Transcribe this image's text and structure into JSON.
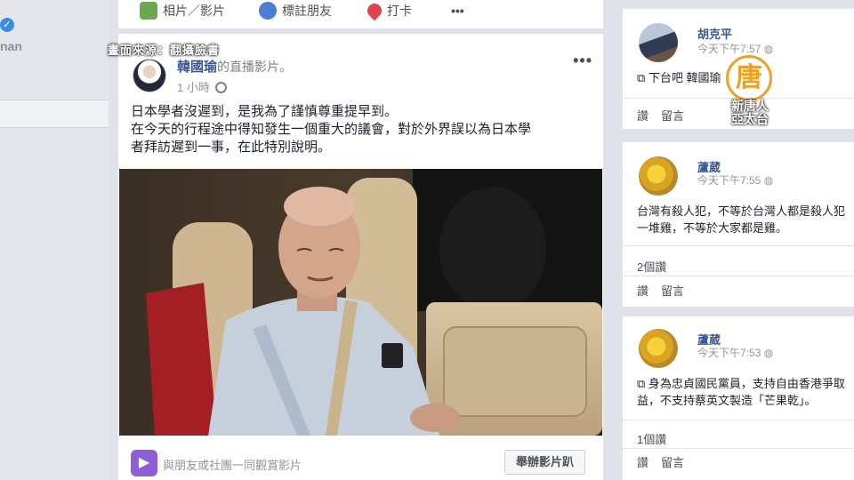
{
  "left": {
    "name_fragment": "nan"
  },
  "composer": {
    "photo_label": "相片／影片",
    "tag_label": "標註朋友",
    "checkin_label": "打卡",
    "more_label": "•••"
  },
  "overlay": {
    "source": "畫面來源：翻攝臉書"
  },
  "post": {
    "author": "韓國瑜",
    "suffix": "的直播影片。",
    "time": "1 小時",
    "more": "•••",
    "text_lines": [
      "日本學者沒遲到，是我為了謹慎尊重提早到。",
      "在今天的行程途中得知發生一個重大的議會，對於外界誤以為日本學",
      "者拜訪遲到一事，在此特別說明。"
    ],
    "share_text": "與朋友或社團一同觀賞影片",
    "party_button": "舉辦影片趴"
  },
  "comments": [
    {
      "name": "胡克平",
      "time": "今天下午7:57",
      "text": "下台吧 韓國瑜",
      "actions": [
        "讚",
        "留言"
      ]
    },
    {
      "name": "蘆葳",
      "time": "今天下午7:55",
      "text_lines": [
        "台灣有殺人犯，不等於台灣人都是殺人犯",
        "一堆雞，不等於大家都是雞。"
      ],
      "count": "2個讚",
      "actions": [
        "讚",
        "留言"
      ]
    },
    {
      "name": "蘆葳",
      "time": "今天下午7:53",
      "text_lines": [
        "身為忠貞國民黨員，支持自由香港爭取",
        "益，不支持蔡英文製造「芒果乾」。"
      ],
      "count": "1個讚",
      "actions": [
        "讚",
        "留言"
      ]
    }
  ],
  "watermark": {
    "glyph": "唐",
    "line1": "新唐人",
    "line2": "亞太台"
  },
  "colors": {
    "link": "#365899",
    "accent_purple": "#8c5fd4",
    "logo_orange": "#f0a020"
  }
}
